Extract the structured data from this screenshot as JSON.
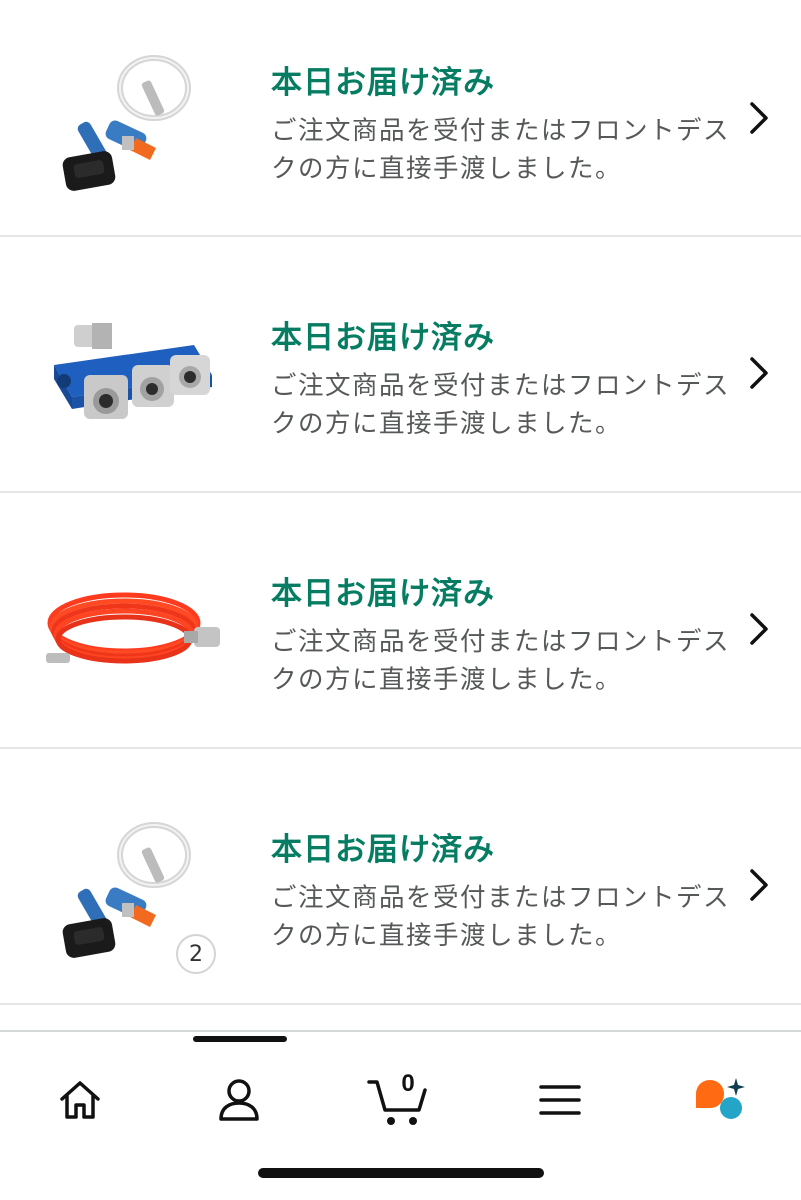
{
  "orders": [
    {
      "status": "本日お届け済み",
      "description": "ご注文商品を受付またはフロントデスクの方に直接手渡しました。",
      "product_image": "tire-inflator-kit"
    },
    {
      "status": "本日お届け済み",
      "description": "ご注文商品を受付またはフロントデスクの方に直接手渡しました。",
      "product_image": "air-manifold-coupler"
    },
    {
      "status": "本日お届け済み",
      "description": "ご注文商品を受付またはフロントデスクの方に直接手渡しました。",
      "product_image": "red-air-hose"
    },
    {
      "status": "本日お届け済み",
      "description": "ご注文商品を受付またはフロントデスクの方に直接手渡しました。",
      "product_image": "tire-inflator-kit",
      "quantity": "2"
    }
  ],
  "bottom_nav": {
    "items": [
      "home-icon",
      "account-icon",
      "cart-icon",
      "menu-icon",
      "assistant-icon"
    ],
    "cart_count": "0"
  },
  "colors": {
    "status_green": "#067d62",
    "description_gray": "#565959",
    "assistant_orange": "#ff6a13",
    "assistant_teal": "#24a4c7"
  }
}
